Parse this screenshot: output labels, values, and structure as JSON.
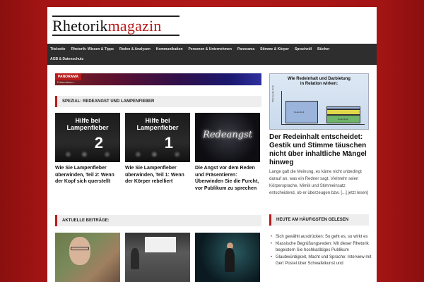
{
  "logo": {
    "part1": "Rhetorik",
    "part2": "magazin"
  },
  "nav": {
    "row1": [
      "Titelseite",
      "Rhetorik: Wissen & Tipps",
      "Reden & Analysen",
      "Kommunikation",
      "Personen & Unternehmen",
      "Panorama",
      "Stimme & Körper",
      "Sprachstil",
      "Bücher"
    ],
    "row2": [
      "AGB & Datenschutz"
    ]
  },
  "banner": {
    "label": "PANORAMA",
    "sub": "Präsentieren..."
  },
  "spezial": {
    "heading": "SPEZIAL: REDEANGST UND LAMPENFIEBER",
    "cards": [
      {
        "thumb_line1": "Hilfe bei",
        "thumb_line2": "Lampenfieber",
        "thumb_num": "2",
        "title": "Wie Sie Lampenfieber überwinden, Teil 2: Wenn der Kopf sich querstellt"
      },
      {
        "thumb_line1": "Hilfe bei",
        "thumb_line2": "Lampenfieber",
        "thumb_num": "1",
        "title": "Wie Sie Lampenfieber überwinden, Teil 1: Wenn der Körper rebelliert"
      },
      {
        "thumb_word": "Redeangst",
        "title": "Die Angst vor dem Reden und Präsentieren: Überwinden Sie die Furcht, vor Publikum zu sprechen"
      }
    ]
  },
  "aktuelle": {
    "heading": "AKTUELLE BEITRÄGE:"
  },
  "feature": {
    "chart_title_line1": "Wie Redeinhalt und Darbietung",
    "chart_title_line2": "in Relation wirken:",
    "chart_ylabel": "Wirkung der Rede",
    "chart_bar1_label": "Redeinhalt",
    "chart_bar2_label": "Redeinhalt",
    "title": "Der Redeinhalt entscheidet: Gestik und Stimme täuschen nicht über inhaltliche Mängel hinweg",
    "excerpt": "Lange galt die Meinung, es käme nicht unbedingt darauf an, was ein Redner sagt. Vielmehr seien Körpersprache, Mimik und Stimmeinsatz entscheidend, ob er überzeugen bzw. [...] jetzt lesen]"
  },
  "most_read": {
    "heading": "HEUTE AM HÄUFIGSTEN GELESEN",
    "items": [
      "Sich gewählt ausdrücken: So geht es, so wirkt es",
      "Klassische Begrüßungsreden: Mit dieser Rhetorik begeistern Sie hochkarätiges Publikum",
      "Glaubwürdigkeit, Macht und Sprache: Interview mit Gert Postel über Schwafelkunst und"
    ]
  },
  "colors": {
    "accent": "#b71c1c",
    "nav_bg": "#2e2e2e",
    "page_bg": "#b01818"
  }
}
